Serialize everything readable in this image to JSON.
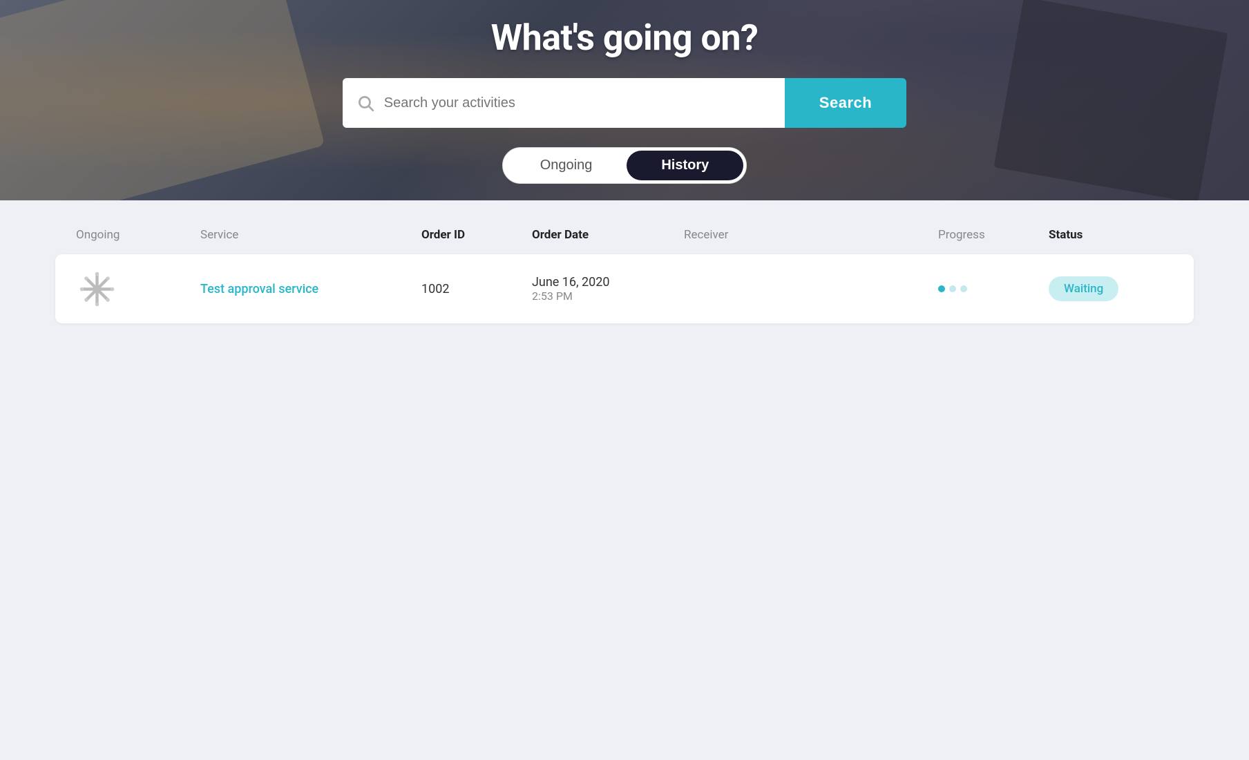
{
  "hero": {
    "title": "What's going on?",
    "search_placeholder": "Search your activities",
    "search_button_label": "Search"
  },
  "tabs": {
    "ongoing_label": "Ongoing",
    "history_label": "History",
    "active": "history"
  },
  "table": {
    "columns": {
      "col1": "Ongoing",
      "col2": "Service",
      "col3": "Order ID",
      "col4": "Order Date",
      "col5": "Receiver",
      "col6": "Progress",
      "col7": "Status"
    },
    "rows": [
      {
        "service_name": "Test approval service",
        "order_id": "1002",
        "order_date": "June 16, 2020",
        "order_time": "2:53 PM",
        "receiver": "",
        "status": "Waiting"
      }
    ]
  }
}
